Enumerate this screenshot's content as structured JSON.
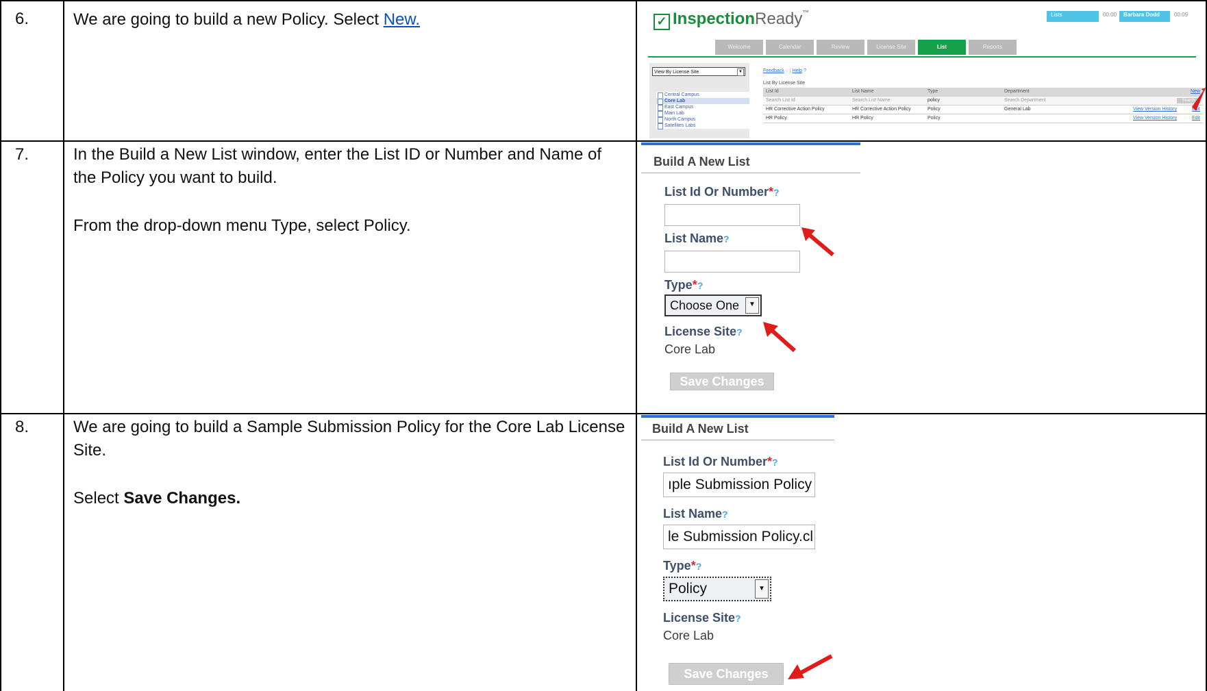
{
  "rows": [
    {
      "number": "6.",
      "text_before_link": "We are going to build a new Policy.  Select ",
      "link_text": "New."
    },
    {
      "number": "7.",
      "paragraph1": "In the Build a New List window, enter the List ID or Number and Name of the Policy you want to build.",
      "paragraph2": "From the drop-down menu Type, select Policy."
    },
    {
      "number": "8.",
      "paragraph1": "We are going to build a Sample Submission Policy for the Core Lab License Site.",
      "paragraph2_prefix": "Select ",
      "paragraph2_bold": "Save Changes."
    }
  ],
  "screenshot_app": {
    "logo_main": "Inspection",
    "logo_ready": "Ready",
    "logo_tm": "™",
    "topbar": [
      "Lists",
      "00:00",
      "Barbara Dodd",
      "00:09"
    ],
    "tabs": [
      "Welcome",
      "Calendar",
      "Review",
      "License Site",
      "List",
      "Reports"
    ],
    "active_tab": "List",
    "view_select": "View By License Site",
    "feedback": "Feedback",
    "help": "Help",
    "list_by": "List By License Site",
    "tree": [
      "Central Campus",
      "Core Lab",
      "East Campus",
      "Main Lab",
      "North Campus",
      "Satellites Labs"
    ],
    "selected_tree": "Core Lab",
    "grid_headers": [
      "List Id",
      "List Name",
      "Type",
      "Department",
      "New"
    ],
    "grid_search": [
      "Search List Id",
      "Search List Name",
      "policy",
      "Search Department",
      "Search"
    ],
    "grid_rows": [
      [
        "HR Corrective Action Policy",
        "HR Corrective Action Policy",
        "Policy",
        "General Lab",
        "View Version History",
        "Edit"
      ],
      [
        "HR Policy",
        "HR Policy",
        "Policy",
        "",
        "View Version History",
        "Edit"
      ]
    ]
  },
  "form_empty": {
    "title": "Build A New List",
    "label_id": "List Id Or Number",
    "label_name": "List Name",
    "label_type": "Type",
    "type_value": "Choose One",
    "label_site": "License Site",
    "site_value": "Core Lab",
    "save_button": "Save Changes",
    "required_mark": "*",
    "help_mark": "?"
  },
  "form_filled": {
    "title": "Build A New List",
    "label_id": "List Id Or Number",
    "id_value": "ıple Submission Policy",
    "label_name": "List Name",
    "name_value": "le Submission Policy.cl",
    "label_type": "Type",
    "type_value": "Policy",
    "label_site": "License Site",
    "site_value": "Core Lab",
    "save_button": "Save Changes",
    "required_mark": "*",
    "help_mark": "?"
  },
  "colors": {
    "brand_green": "#15a14a",
    "link_blue": "#0b4fc7",
    "arrow_red": "#e01b1b",
    "label_navy": "#3d4f6b"
  }
}
